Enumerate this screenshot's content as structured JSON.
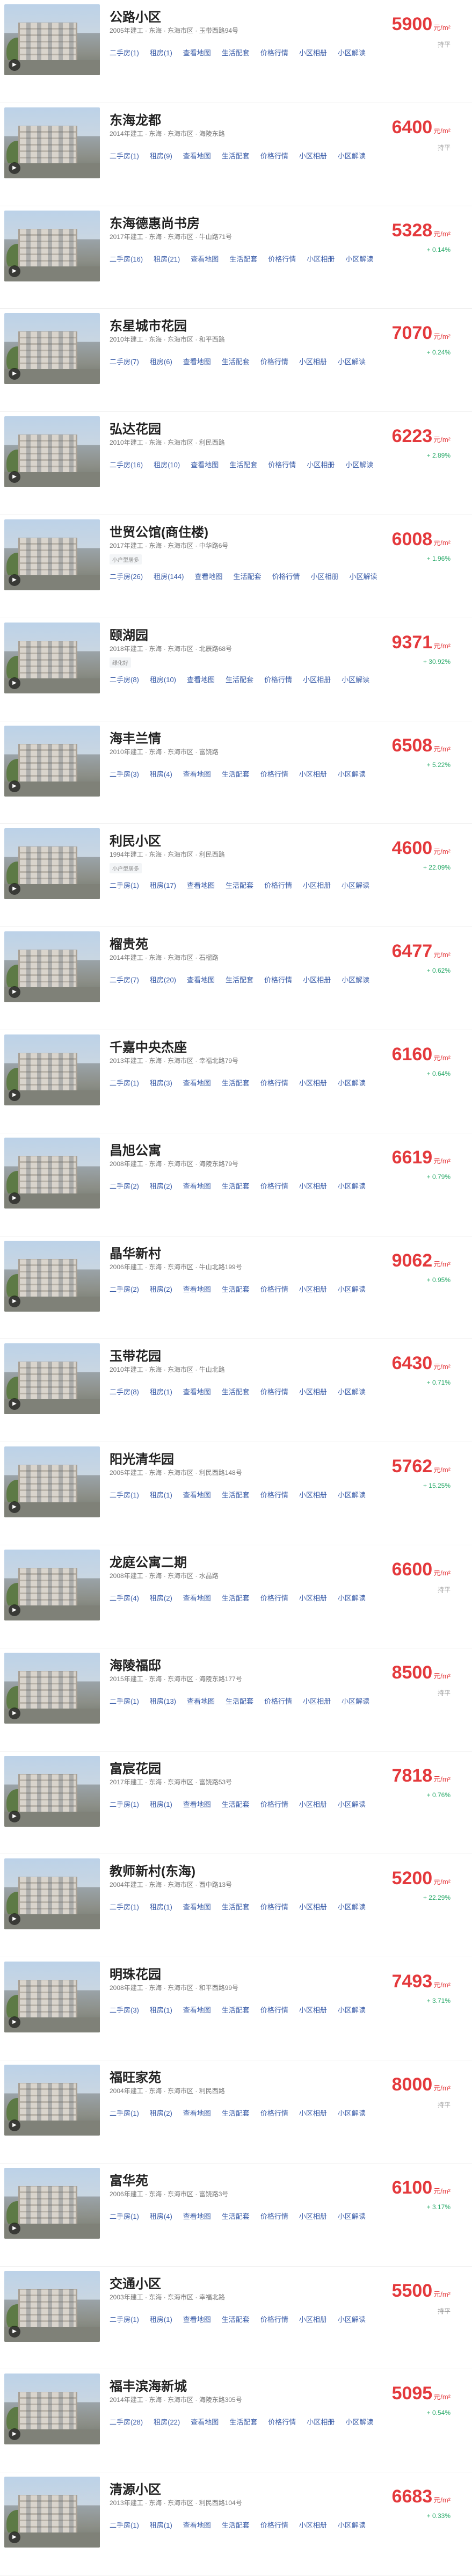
{
  "link_labels": [
    "二手房",
    "租房",
    "查看地图",
    "生活配套",
    "价格行情",
    "小区相册",
    "小区解读"
  ],
  "price_unit": "元/m²",
  "items": [
    {
      "name": "公路小区",
      "meta": "2005年建工 · 东海 · 东海市区 · 玉带西路94号",
      "tag": "",
      "counts": [
        "(1)",
        "(1)"
      ],
      "price": "5900",
      "change": "持平",
      "flat": true
    },
    {
      "name": "东海龙都",
      "meta": "2014年建工 · 东海 · 东海市区 · 海陵东路",
      "tag": "",
      "counts": [
        "(1)",
        "(9)"
      ],
      "price": "6400",
      "change": "持平",
      "flat": true
    },
    {
      "name": "东海德惠尚书房",
      "meta": "2017年建工 · 东海 · 东海市区 · 牛山路71号",
      "tag": "",
      "counts": [
        "(16)",
        "(21)"
      ],
      "price": "5328",
      "change": "+ 0.14%",
      "flat": false
    },
    {
      "name": "东星城市花园",
      "meta": "2010年建工 · 东海 · 东海市区 · 和平西路",
      "tag": "",
      "counts": [
        "(7)",
        "(6)"
      ],
      "price": "7070",
      "change": "+ 0.24%",
      "flat": false
    },
    {
      "name": "弘达花园",
      "meta": "2010年建工 · 东海 · 东海市区 · 利民西路",
      "tag": "",
      "counts": [
        "(16)",
        "(10)"
      ],
      "price": "6223",
      "change": "+ 2.89%",
      "flat": false
    },
    {
      "name": "世贸公馆(商住楼)",
      "meta": "2017年建工 · 东海 · 东海市区 · 中华路6号",
      "tag": "小户型居多",
      "counts": [
        "(26)",
        "(144)"
      ],
      "price": "6008",
      "change": "+ 1.96%",
      "flat": false
    },
    {
      "name": "颐湖园",
      "meta": "2018年建工 · 东海 · 东海市区 · 北辰路68号",
      "tag": "绿化好",
      "counts": [
        "(8)",
        "(10)"
      ],
      "price": "9371",
      "change": "+ 30.92%",
      "flat": false
    },
    {
      "name": "海丰兰情",
      "meta": "2010年建工 · 东海 · 东海市区 · 富饶路",
      "tag": "",
      "counts": [
        "(3)",
        "(4)"
      ],
      "price": "6508",
      "change": "+ 5.22%",
      "flat": false
    },
    {
      "name": "利民小区",
      "meta": "1994年建工 · 东海 · 东海市区 · 利民西路",
      "tag": "小户型居多",
      "counts": [
        "(1)",
        "(17)"
      ],
      "price": "4600",
      "change": "+ 22.09%",
      "flat": false
    },
    {
      "name": "榴贵苑",
      "meta": "2014年建工 · 东海 · 东海市区 · 石榴路",
      "tag": "",
      "counts": [
        "(7)",
        "(20)"
      ],
      "price": "6477",
      "change": "+ 0.62%",
      "flat": false
    },
    {
      "name": "千嘉中央杰座",
      "meta": "2013年建工 · 东海 · 东海市区 · 幸福北路79号",
      "tag": "",
      "counts": [
        "(1)",
        "(3)"
      ],
      "price": "6160",
      "change": "+ 0.64%",
      "flat": false
    },
    {
      "name": "昌旭公寓",
      "meta": "2008年建工 · 东海 · 东海市区 · 海陵东路79号",
      "tag": "",
      "counts": [
        "(2)",
        "(2)"
      ],
      "price": "6619",
      "change": "+ 0.79%",
      "flat": false
    },
    {
      "name": "晶华新村",
      "meta": "2006年建工 · 东海 · 东海市区 · 牛山北路199号",
      "tag": "",
      "counts": [
        "(2)",
        "(2)"
      ],
      "price": "9062",
      "change": "+ 0.95%",
      "flat": false
    },
    {
      "name": "玉带花园",
      "meta": "2010年建工 · 东海 · 东海市区 · 牛山北路",
      "tag": "",
      "counts": [
        "(8)",
        "(1)"
      ],
      "price": "6430",
      "change": "+ 0.71%",
      "flat": false
    },
    {
      "name": "阳光清华园",
      "meta": "2005年建工 · 东海 · 东海市区 · 利民西路148号",
      "tag": "",
      "counts": [
        "(1)",
        "(1)"
      ],
      "price": "5762",
      "change": "+ 15.25%",
      "flat": false
    },
    {
      "name": "龙庭公寓二期",
      "meta": "2008年建工 · 东海 · 东海市区 · 水晶路",
      "tag": "",
      "counts": [
        "(4)",
        "(2)"
      ],
      "price": "6600",
      "change": "持平",
      "flat": true
    },
    {
      "name": "海陵福邸",
      "meta": "2015年建工 · 东海 · 东海市区 · 海陵东路177号",
      "tag": "",
      "counts": [
        "(1)",
        "(13)"
      ],
      "price": "8500",
      "change": "持平",
      "flat": true
    },
    {
      "name": "富宸花园",
      "meta": "2017年建工 · 东海 · 东海市区 · 富饶路53号",
      "tag": "",
      "counts": [
        "(1)",
        "(1)"
      ],
      "price": "7818",
      "change": "+ 0.76%",
      "flat": false
    },
    {
      "name": "教师新村(东海)",
      "meta": "2004年建工 · 东海 · 东海市区 · 西中路13号",
      "tag": "",
      "counts": [
        "(1)",
        "(1)"
      ],
      "price": "5200",
      "change": "+ 22.29%",
      "flat": false
    },
    {
      "name": "明珠花园",
      "meta": "2008年建工 · 东海 · 东海市区 · 和平西路99号",
      "tag": "",
      "counts": [
        "(3)",
        "(1)"
      ],
      "price": "7493",
      "change": "+ 3.71%",
      "flat": false
    },
    {
      "name": "福旺家苑",
      "meta": "2004年建工 · 东海 · 东海市区 · 利民西路",
      "tag": "",
      "counts": [
        "(1)",
        "(2)"
      ],
      "price": "8000",
      "change": "持平",
      "flat": true
    },
    {
      "name": "富华苑",
      "meta": "2006年建工 · 东海 · 东海市区 · 富饶路3号",
      "tag": "",
      "counts": [
        "(1)",
        "(4)"
      ],
      "price": "6100",
      "change": "+ 3.17%",
      "flat": false
    },
    {
      "name": "交通小区",
      "meta": "2003年建工 · 东海 · 东海市区 · 幸福北路",
      "tag": "",
      "counts": [
        "(1)",
        "(1)"
      ],
      "price": "5500",
      "change": "持平",
      "flat": true
    },
    {
      "name": "福丰滨海新城",
      "meta": "2014年建工 · 东海 · 东海市区 · 海陵东路305号",
      "tag": "",
      "counts": [
        "(28)",
        "(22)"
      ],
      "price": "5095",
      "change": "+ 0.54%",
      "flat": false
    },
    {
      "name": "清源小区",
      "meta": "2013年建工 · 东海 · 东海市区 · 利民西路104号",
      "tag": "",
      "counts": [
        "(1)",
        "(1)"
      ],
      "price": "6683",
      "change": "+ 0.33%",
      "flat": false
    }
  ]
}
